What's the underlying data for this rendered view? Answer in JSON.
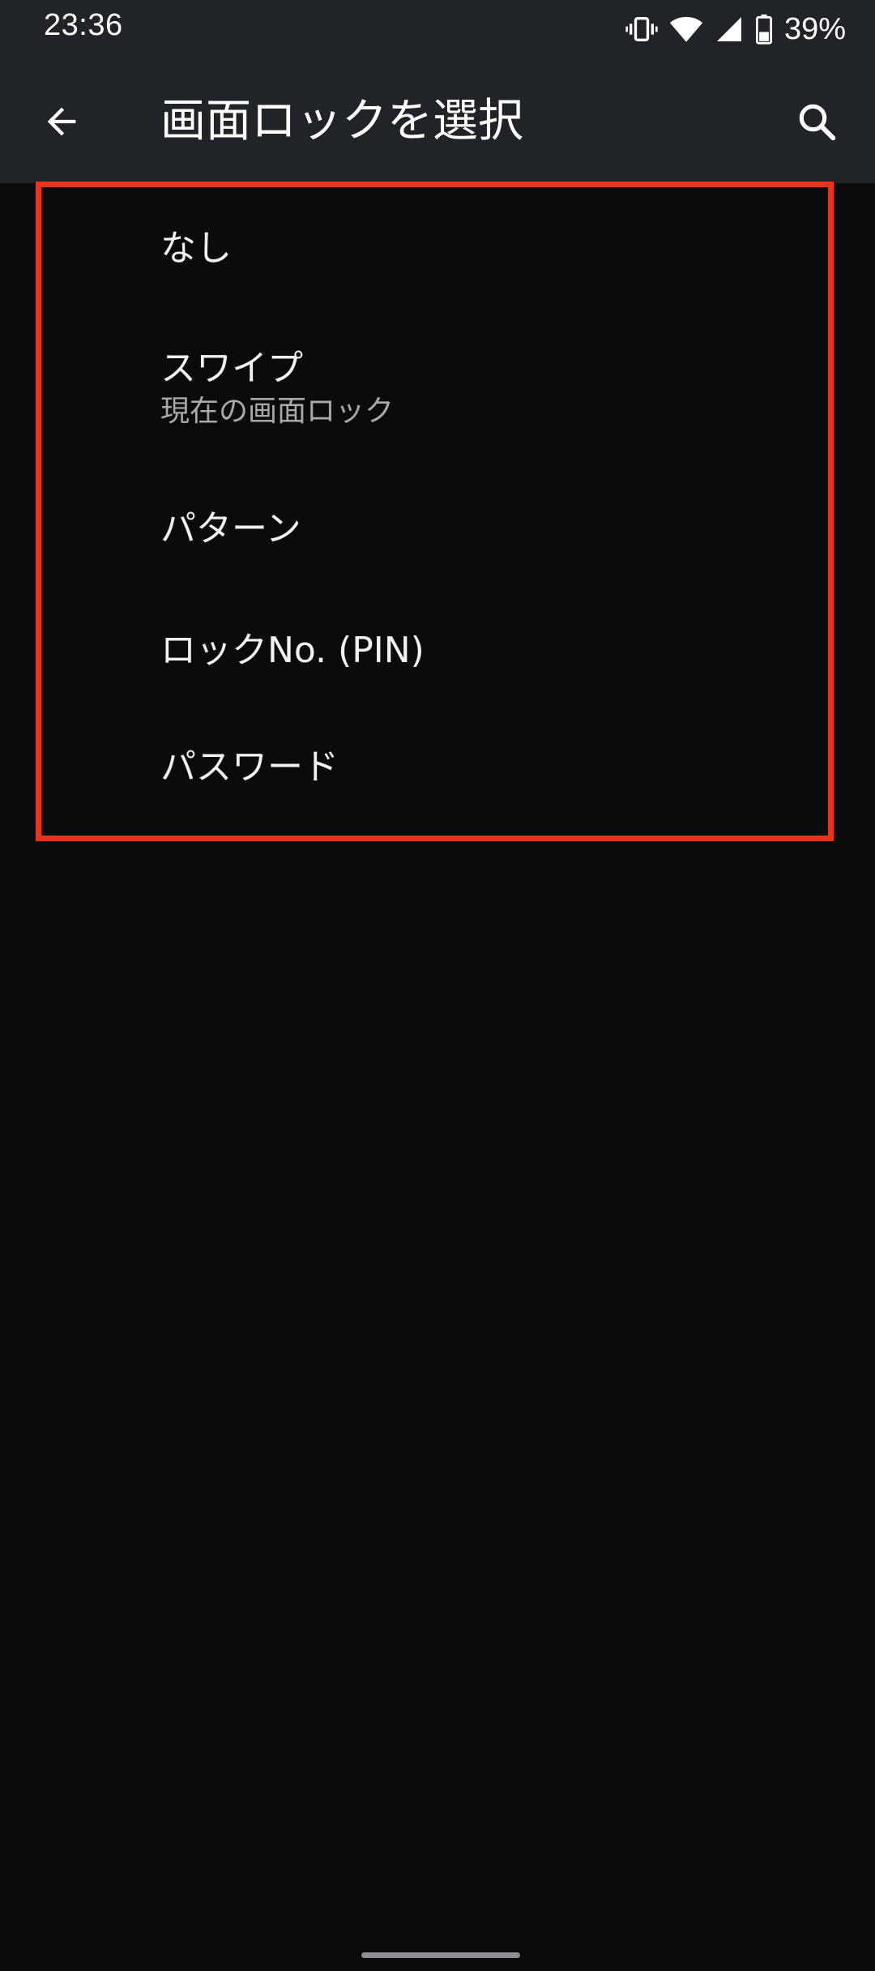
{
  "status_bar": {
    "time": "23:36",
    "battery_percent": "39%",
    "icons": [
      "vibrate-icon",
      "wifi-icon",
      "signal-icon",
      "battery-icon"
    ]
  },
  "app_bar": {
    "title": "画面ロックを選択",
    "back_icon": "back-arrow-icon",
    "search_icon": "search-icon"
  },
  "options": [
    {
      "title": "なし",
      "subtitle": ""
    },
    {
      "title": "スワイプ",
      "subtitle": "現在の画面ロック"
    },
    {
      "title": "パターン",
      "subtitle": ""
    },
    {
      "title": "ロックNo. (PIN)",
      "subtitle": ""
    },
    {
      "title": "パスワード",
      "subtitle": ""
    }
  ],
  "colors": {
    "background": "#0a0b0d",
    "app_bar": "#202328",
    "highlight_frame": "#e8341c",
    "primary_text": "#f1f1f1",
    "secondary_text": "#a7a9ad"
  }
}
